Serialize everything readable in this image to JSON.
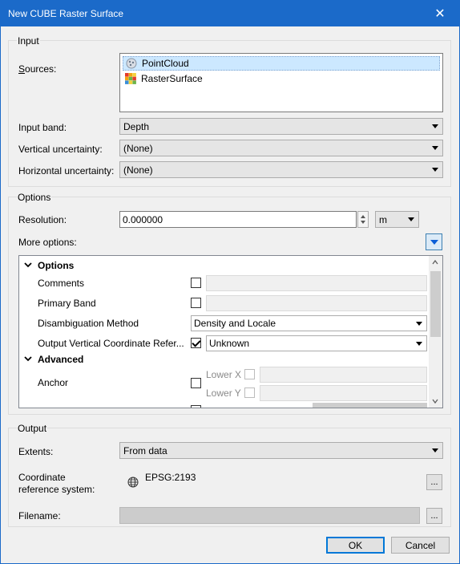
{
  "window": {
    "title": "New CUBE Raster Surface",
    "close_glyph": "✕"
  },
  "input": {
    "group_title": "Input",
    "sources_label": "Sources:",
    "sources": [
      {
        "label": "PointCloud",
        "icon": "point-cloud-icon",
        "selected": true
      },
      {
        "label": "RasterSurface",
        "icon": "raster-surface-icon",
        "selected": false
      }
    ],
    "input_band_label": "Input band:",
    "input_band_value": "Depth",
    "vertical_uncertainty_label": "Vertical uncertainty:",
    "vertical_uncertainty_value": "(None)",
    "horizontal_uncertainty_label": "Horizontal uncertainty:",
    "horizontal_uncertainty_value": "(None)"
  },
  "options": {
    "group_title": "Options",
    "resolution_label": "Resolution:",
    "resolution_value": "0.000000",
    "resolution_unit": "m",
    "more_options_label": "More options:",
    "grid": {
      "section_options": "Options",
      "comments_label": "Comments",
      "primary_band_label": "Primary Band",
      "disambiguation_label": "Disambiguation Method",
      "disambiguation_value": "Density and Locale",
      "output_vcrs_label": "Output Vertical Coordinate Refer...",
      "output_vcrs_value": "Unknown",
      "section_advanced": "Advanced",
      "anchor_label": "Anchor",
      "lower_x_label": "Lower X",
      "lower_y_label": "Lower Y"
    }
  },
  "output": {
    "group_title": "Output",
    "extents_label": "Extents:",
    "extents_value": "From data",
    "crs_label_line1": "Coordinate",
    "crs_label_line2": "reference system:",
    "crs_value": "EPSG:2193",
    "crs_browse": "...",
    "filename_label": "Filename:",
    "filename_value": "",
    "filename_browse": "..."
  },
  "buttons": {
    "ok": "OK",
    "cancel": "Cancel"
  },
  "colors": {
    "titlebar": "#1b6ac9",
    "selection": "#cce8ff",
    "accent": "#0078d7"
  }
}
